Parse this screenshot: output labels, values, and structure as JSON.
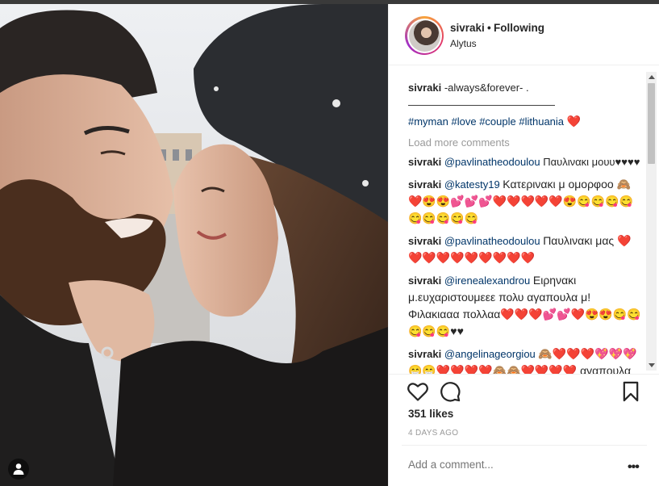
{
  "post": {
    "username": "sivraki",
    "separator": "•",
    "follow_state": "Following",
    "location": "Alytus",
    "caption": "-always&forever- .",
    "caption_rule": "——————————————",
    "hashtags": [
      "#myman",
      "#love",
      "#couple",
      "#lithuania"
    ],
    "caption_emoji": "❤️",
    "load_more": "Load more comments",
    "likes": "351 likes",
    "time_ago": "4 DAYS AGO",
    "add_comment_placeholder": "Add a comment...",
    "more_options": "•••"
  },
  "comments": [
    {
      "user": "sivraki",
      "mention": "@pavlinatheodoulou",
      "text": "Παυλινακι μουυ♥♥♥♥"
    },
    {
      "user": "sivraki",
      "mention": "@katesty19",
      "text": "Κατερινακι μ ομορφοο 🙈❤️😍😍💕💕💕❤️❤️❤️❤️❤️😍😋😋😋😋😋😋😋😋😋"
    },
    {
      "user": "sivraki",
      "mention": "@pavlinatheodoulou",
      "text": "Παυλινακι μας ❤️❤️❤️❤️❤️❤️❤️❤️❤️❤️"
    },
    {
      "user": "sivraki",
      "mention": "@irenealexandrou",
      "text": "Ειρηνακι μ.ευχαριστουμεεε πολυ αγαπουλα μ! Φιλακιααα πολλαα❤️❤️❤️💕💕❤️😍😍😋😋😋😋😋♥♥"
    },
    {
      "user": "sivraki",
      "mention": "@angelinageorgiou",
      "text": "🙈❤️❤️❤️💖💖💖😁😁❤️❤️❤️❤️🙈🙈❤️❤️❤️❤️ αγαπουλα μ!!"
    }
  ],
  "icons": {
    "like": "heart-outline-icon",
    "comment": "speech-bubble-icon",
    "save": "bookmark-icon",
    "tag": "person-tag-icon"
  },
  "colors": {
    "link": "#003569",
    "muted": "#999999",
    "heart": "#e0192a",
    "text": "#262626"
  }
}
